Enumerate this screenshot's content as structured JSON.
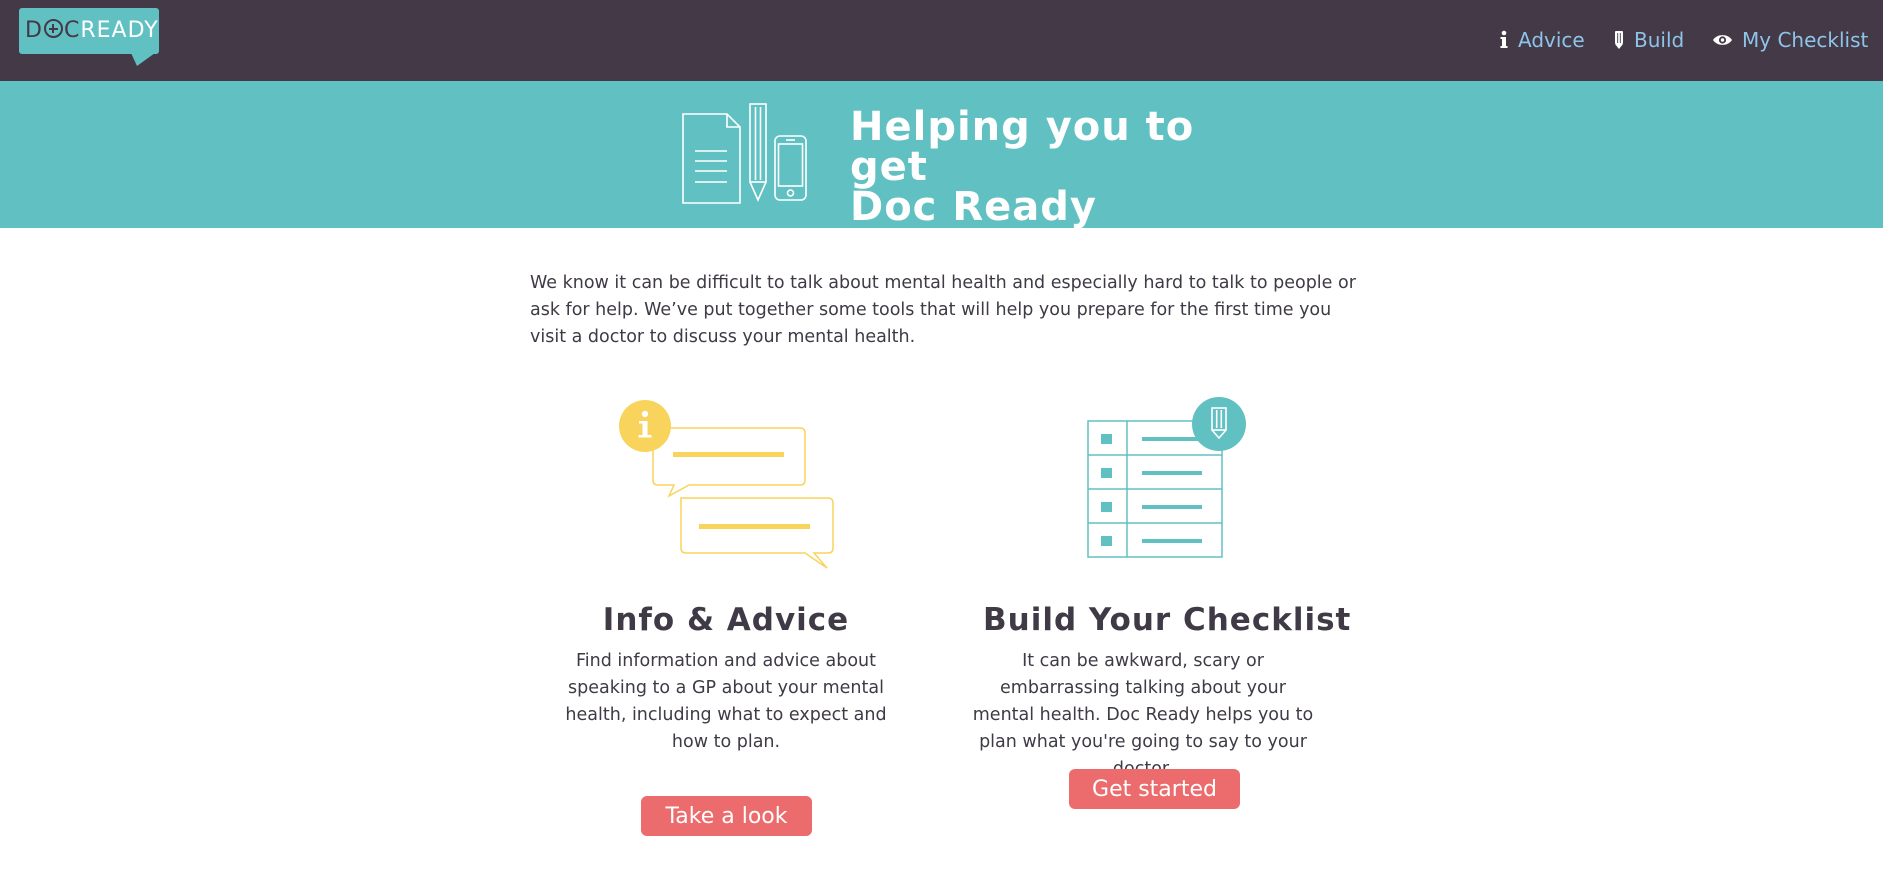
{
  "brand": {
    "logo_doc": "D",
    "logo_oc": "C",
    "logo_ready": "READY"
  },
  "nav": [
    {
      "label": "Advice",
      "icon": "info-icon"
    },
    {
      "label": "Build",
      "icon": "pencil-icon"
    },
    {
      "label": "My Checklist",
      "icon": "eye-icon"
    }
  ],
  "hero": {
    "title_line1": "Helping you to get",
    "title_line2": "Doc Ready"
  },
  "intro": {
    "text": "We know it can be difficult to talk about mental health and especially hard to talk to people or ask for help. We’ve put together some tools that will help you prepare for the first time you visit a doctor to discuss your mental health."
  },
  "cards": [
    {
      "title": "Info & Advice",
      "body": "Find information and advice about speaking to a GP about your mental health, including what to expect and how to plan.",
      "button": "Take a look",
      "icon": "speech-bubbles-info-icon"
    },
    {
      "title": "Build Your Checklist",
      "body": "It can be awkward, scary or embarrassing talking about your mental health. Doc Ready helps you to plan what you're going to say to your doctor.",
      "button": "Get started",
      "icon": "checklist-pencil-icon"
    }
  ],
  "colors": {
    "navbar": "#433947",
    "teal": "#61c0c2",
    "yellow": "#f8d45c",
    "button": "#ec6b6d",
    "nav_link": "#8fc4e9",
    "text": "#3f3a45"
  }
}
